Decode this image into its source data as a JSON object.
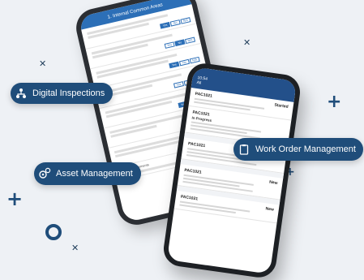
{
  "badges": {
    "digital_inspections": "Digital Inspections",
    "asset_management": "Asset Management",
    "work_order_management": "Work Order Management"
  },
  "phone_left": {
    "header_title": "1. Internal Common Areas",
    "answer_options": [
      "Yes",
      "No",
      "N/A"
    ],
    "section_label": "Additional Comments"
  },
  "phone_right": {
    "header_time": "10:54",
    "header_title": "All",
    "section_label": "In Progress",
    "cards": [
      {
        "code": "PAC1021",
        "status": "Started"
      },
      {
        "code": "PAC1021",
        "status": "In Progress"
      },
      {
        "code": "PAC1021",
        "status": ""
      },
      {
        "code": "PAC1021",
        "status": "New"
      },
      {
        "code": "PAC1021",
        "status": "New"
      }
    ]
  },
  "icons": [
    "workflow-icon",
    "gears-icon",
    "clipboard-icon"
  ],
  "colors": {
    "navy": "#1f4d7a",
    "blue": "#2c6fb7",
    "background": "#eef1f5"
  }
}
